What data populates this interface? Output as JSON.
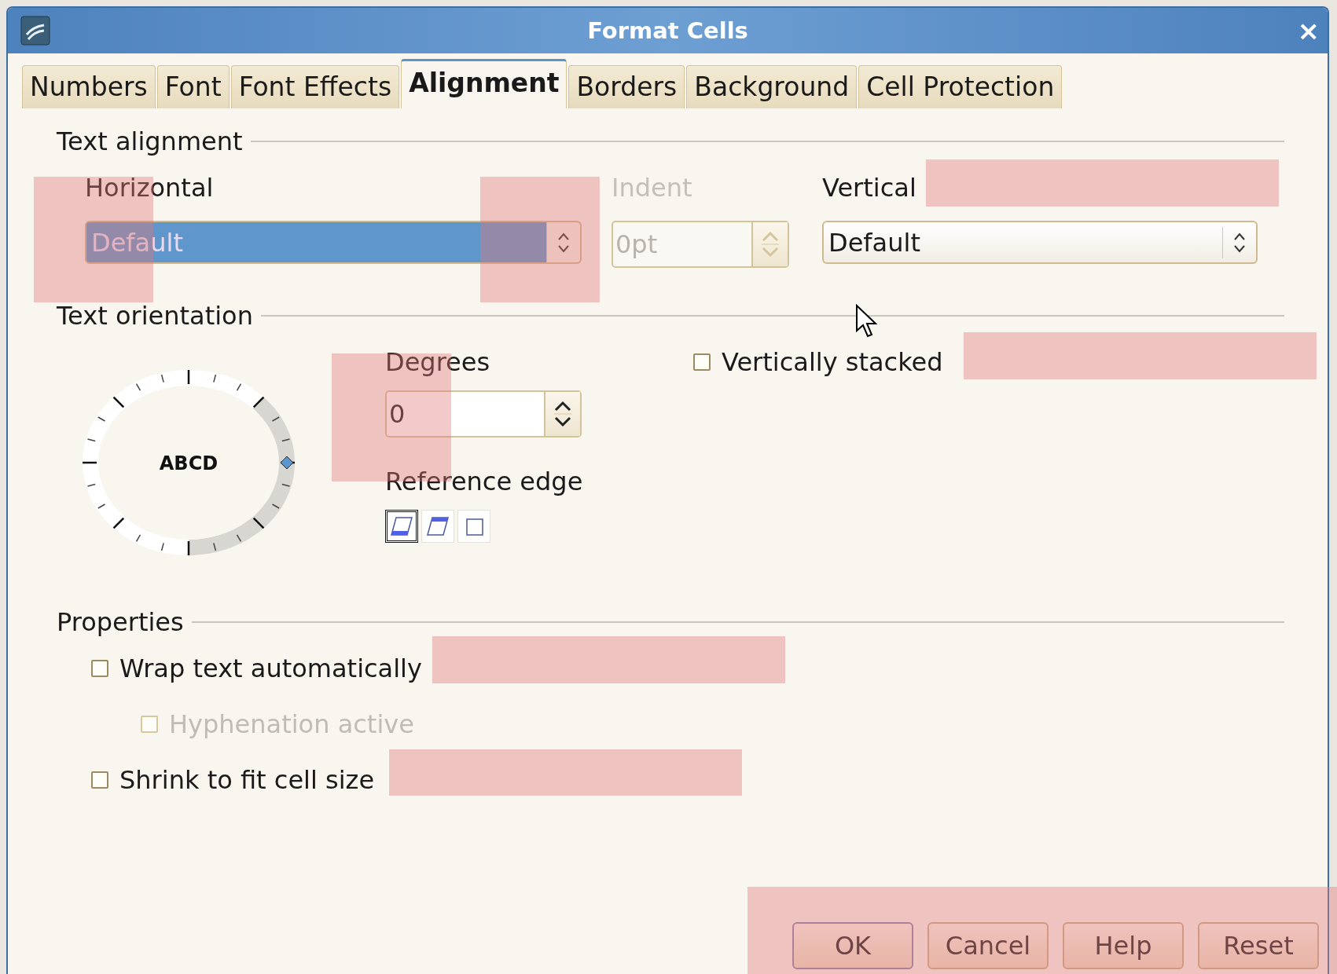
{
  "window": {
    "title": "Format Cells",
    "close": "×"
  },
  "tabs": [
    {
      "label": "Numbers",
      "selected": false
    },
    {
      "label": "Font",
      "selected": false
    },
    {
      "label": "Font Effects",
      "selected": false
    },
    {
      "label": "Alignment",
      "selected": true
    },
    {
      "label": "Borders",
      "selected": false
    },
    {
      "label": "Background",
      "selected": false
    },
    {
      "label": "Cell Protection",
      "selected": false
    }
  ],
  "text_alignment": {
    "heading": "Text alignment",
    "horizontal": {
      "label": "Horizontal",
      "value": "Default",
      "focused": true
    },
    "indent": {
      "label": "Indent",
      "value": "0pt",
      "disabled": true
    },
    "vertical": {
      "label": "Vertical",
      "value": "Default",
      "focused": false
    }
  },
  "text_orientation": {
    "heading": "Text orientation",
    "dial_text": "ABCD",
    "degrees": {
      "label": "Degrees",
      "value": "0"
    },
    "reference_edge": {
      "label": "Reference edge",
      "options": [
        {
          "kind": "bottom",
          "selected": true
        },
        {
          "kind": "top",
          "selected": false
        },
        {
          "kind": "inside",
          "selected": false
        }
      ]
    },
    "vertically_stacked": {
      "label": "Vertically stacked",
      "checked": false
    }
  },
  "properties": {
    "heading": "Properties",
    "options": [
      {
        "label": "Wrap text automatically",
        "checked": false,
        "disabled": false,
        "children": [
          {
            "label": "Hyphenation active",
            "checked": false,
            "disabled": true
          }
        ]
      },
      {
        "label": "Shrink to fit cell size",
        "checked": false,
        "disabled": false
      }
    ]
  },
  "buttons": [
    {
      "label": "OK",
      "default": true
    },
    {
      "label": "Cancel",
      "default": false
    },
    {
      "label": "Help",
      "default": false
    },
    {
      "label": "Reset",
      "default": false
    }
  ]
}
